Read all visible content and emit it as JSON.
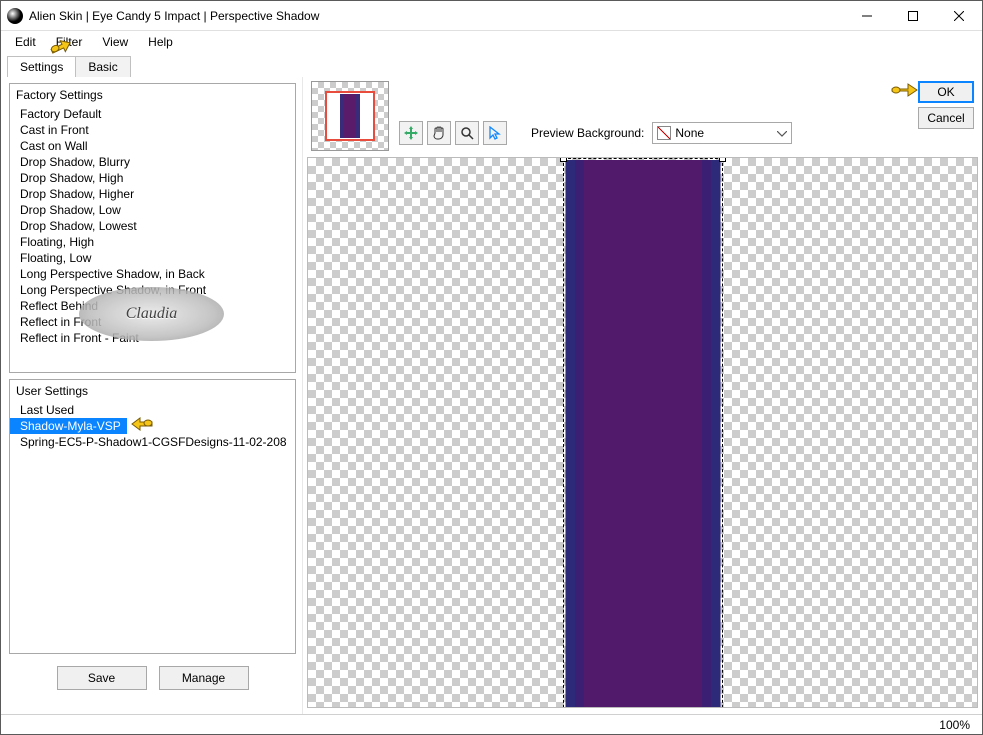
{
  "window": {
    "title": "Alien Skin | Eye Candy 5 Impact | Perspective Shadow"
  },
  "menu": {
    "edit": "Edit",
    "filter": "Filter",
    "view": "View",
    "help": "Help"
  },
  "tabs": {
    "settings": "Settings",
    "basic": "Basic"
  },
  "factory": {
    "header": "Factory Settings",
    "items": [
      "Factory Default",
      "Cast in Front",
      "Cast on Wall",
      "Drop Shadow, Blurry",
      "Drop Shadow, High",
      "Drop Shadow, Higher",
      "Drop Shadow, Low",
      "Drop Shadow, Lowest",
      "Floating, High",
      "Floating, Low",
      "Long Perspective Shadow, in Back",
      "Long Perspective Shadow, in Front",
      "Reflect Behind",
      "Reflect in Front",
      "Reflect in Front - Faint"
    ]
  },
  "user": {
    "header": "User Settings",
    "items": [
      "Last Used",
      "Shadow-Myla-VSP",
      "Spring-EC5-P-Shadow1-CGSFDesigns-11-02-208"
    ],
    "selected_index": 1
  },
  "buttons": {
    "save": "Save",
    "manage": "Manage",
    "ok": "OK",
    "cancel": "Cancel"
  },
  "preview_bg": {
    "label": "Preview Background:",
    "value": "None"
  },
  "status": {
    "zoom": "100%"
  },
  "watermark": "Claudia"
}
